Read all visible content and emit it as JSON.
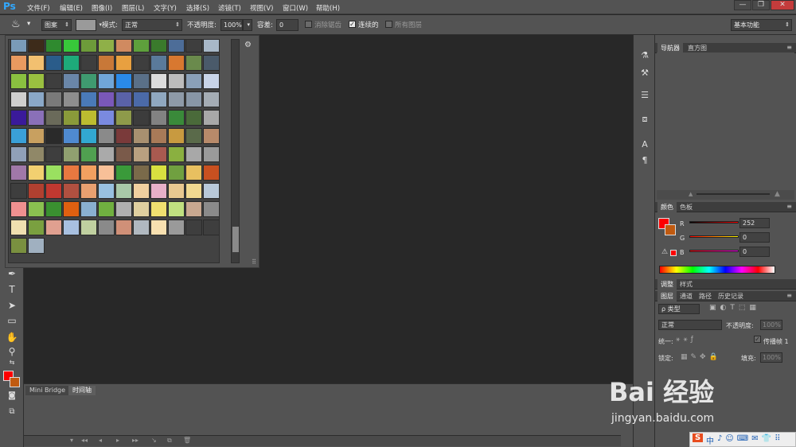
{
  "app": {
    "logo": "Ps"
  },
  "menu": [
    "文件(F)",
    "编辑(E)",
    "图像(I)",
    "图层(L)",
    "文字(Y)",
    "选择(S)",
    "滤镜(T)",
    "视图(V)",
    "窗口(W)",
    "帮助(H)"
  ],
  "window_controls": {
    "minimize": "—",
    "restore": "❐",
    "close": "✕"
  },
  "options": {
    "fill_source": "图案",
    "mode_label": "模式:",
    "mode_value": "正常",
    "opacity_label": "不透明度:",
    "opacity_value": "100%",
    "tolerance_label": "容差:",
    "tolerance_value": "0",
    "antialias_label": "消除锯齿",
    "contiguous_label": "连续的",
    "contiguous_checked": "✓",
    "all_layers_label": "所有图层",
    "workspace": "基本功能"
  },
  "pattern_picker": {
    "gear": "⚙",
    "resize": "⠿",
    "swatch_colors": [
      "#7a9bb8",
      "#3d2b1a",
      "#2f8a2f",
      "#38c83a",
      "#6d9b3a",
      "#8fb048",
      "#d08a60",
      "#5ea03c",
      "#3a7a2c",
      "#4d6d98",
      "#3e3e3e",
      "#a8b8c8",
      "#e89a60",
      "#f2c070",
      "#2a5c8a",
      "#1eaa7a",
      "#3e3e3e",
      "#c87838",
      "#e8a040",
      "#3e3e3e",
      "#5a7a9a",
      "#d87830",
      "#6a8a4c",
      "#4a5a6a",
      "#8ac040",
      "#9ac040",
      "#3e3e3e",
      "#6a86a8",
      "#3f9a70",
      "#70a6d8",
      "#2a8ae8",
      "#5a7088",
      "#dcdcdc",
      "#bcbcbc",
      "#8aa0b8",
      "#c8d4e8",
      "#cfcfcf",
      "#8aa8c8",
      "#7a7a7a",
      "#8e8e8e",
      "#4a7ab8",
      "#7a58b8",
      "#5a62a8",
      "#4b6aa8",
      "#90a8c0",
      "#8e9aa8",
      "#8896a6",
      "#a4acb4",
      "#3a1a9a",
      "#8a70b8",
      "#6a6a5a",
      "#8a9a3a",
      "#bcbc30",
      "#7a8ae0",
      "#8e9a4a",
      "#3c3c3c",
      "#828282",
      "#3a8a3a",
      "#4a6a3a",
      "#a8a8a8",
      "#3aa0d8",
      "#c8a060",
      "#2a2a2a",
      "#4f8ad0",
      "#32a8d0",
      "#8a8a8a",
      "#7a3a3a",
      "#a89070",
      "#a87a58",
      "#c89a40",
      "#5a6a4a",
      "#b88a6a",
      "#90a0b8",
      "#908868",
      "#3e3e3e",
      "#90a070",
      "#50a050",
      "#aaaaaa",
      "#7a5a4a",
      "#b8a080",
      "#a85a50",
      "#8ab040",
      "#a8a8a8",
      "#9a9a9a",
      "#a078a8",
      "#f2d070",
      "#9ae060",
      "#e87840",
      "#f2a060",
      "#f8c098",
      "#3a9a3a",
      "#7a6a4a",
      "#d8e040",
      "#70a040",
      "#e8c060",
      "#c85020",
      "#3e3e3e",
      "#b04030",
      "#c03830",
      "#b05040",
      "#e8a070",
      "#98c0e0",
      "#a8c8a8",
      "#f0d0a0",
      "#e8b0c8",
      "#e8c890",
      "#f0d890",
      "#b8c8d8",
      "#f09090",
      "#8ac050",
      "#3a9030",
      "#e06010",
      "#8ab0d0",
      "#70b040",
      "#b0b0b0",
      "#e0d0a0",
      "#f0e070",
      "#c0e080",
      "#c8a890",
      "#8a8a8a",
      "#f0e0b0",
      "#7aa040",
      "#e0a090",
      "#a8c0e0",
      "#c0d0a0",
      "#8a8a8a",
      "#d09078",
      "#b0b8c0",
      "#f8e0b0",
      "#9a9a9a",
      "#3e3e3e",
      "#3e3e3e",
      "#7a9040",
      "#a0b0c0"
    ]
  },
  "right_strip_icons": [
    "brush-presets-icon",
    "mixer-icon",
    "paragraph-list-icon",
    "layers-comp-icon",
    "character-icon",
    "paragraph-icon"
  ],
  "panels": {
    "navigator_tab": "导航器",
    "histogram_tab": "直方图",
    "color_tab": "颜色",
    "swatches_tab": "色板",
    "r_label": "R",
    "r_value": "252",
    "g_label": "G",
    "g_value": "0",
    "b_label": "B",
    "b_value": "0",
    "adjust_tab": "调整",
    "styles_tab": "样式",
    "layers_tab": "图层",
    "channels_tab": "通道",
    "paths_tab": "路径",
    "history_tab": "历史记录",
    "kind_label": "ρ 类型",
    "blend_mode": "正常",
    "opacity_label": "不透明度:",
    "opacity_value": "100%",
    "unify_label": "统一:",
    "propagate_label": "传播帧 1",
    "lock_label": "锁定:",
    "fill_label": "填充:",
    "fill_value": "100%"
  },
  "bottom": {
    "mini_bridge_tab": "Mini Bridge",
    "timeline_tab": "时间轴"
  },
  "watermark": {
    "logo": "Bai 经验",
    "url": "jingyan.baidu.com"
  },
  "ime": {
    "logo": "S",
    "lang": "中"
  }
}
